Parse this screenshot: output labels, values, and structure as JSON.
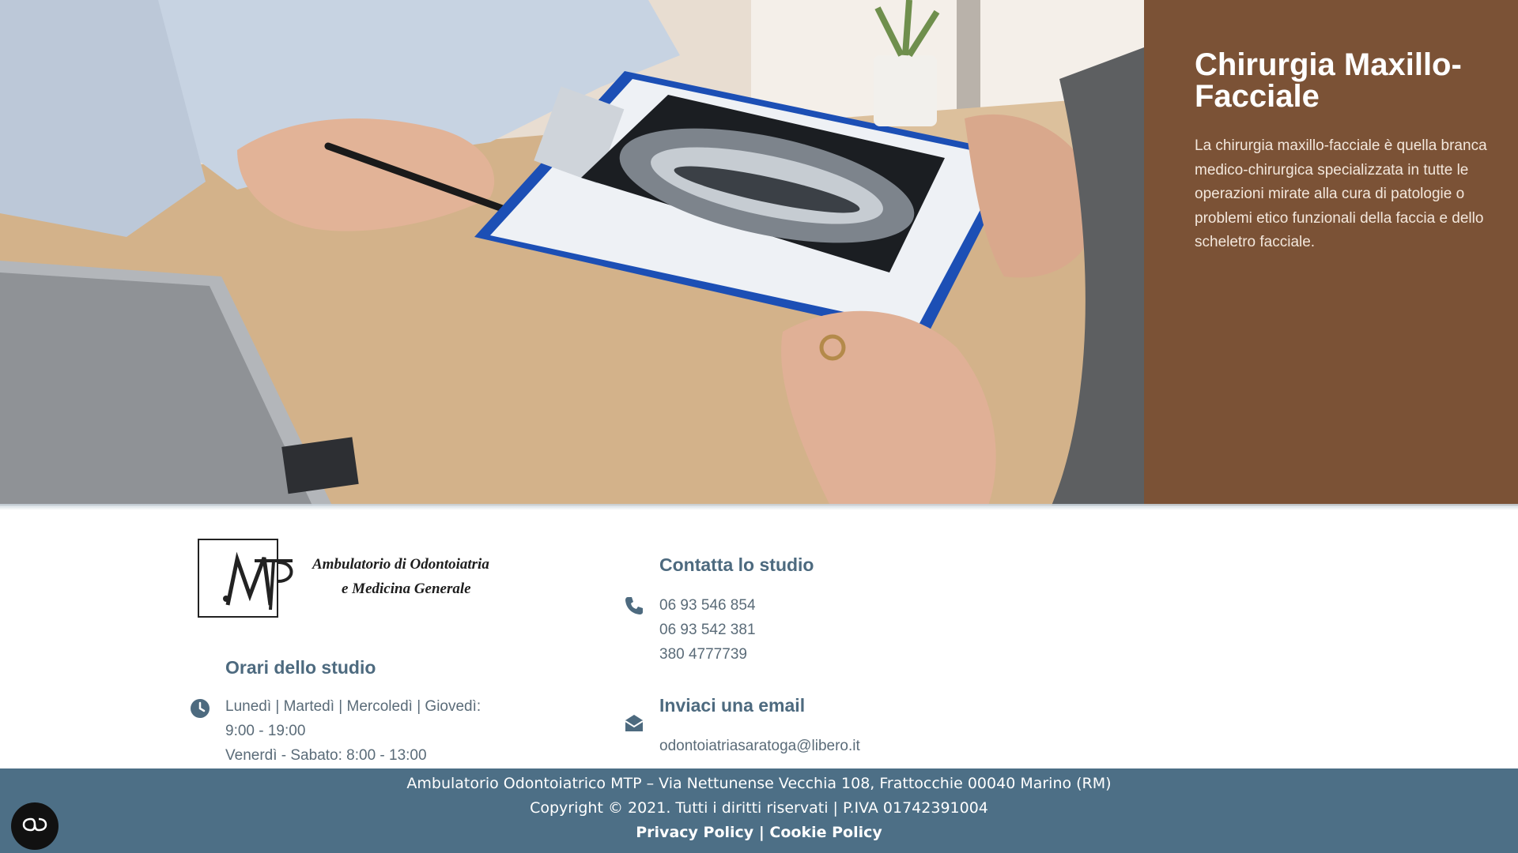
{
  "hero": {
    "title": "Chirurgia Maxillo-Facciale",
    "description": "La chirurgia maxillo-facciale è quella branca medico-chirurgica specializzata in tutte le operazioni mirate alla cura di patologie o problemi etico funzionali della faccia e dello scheletro facciale.",
    "panel_color": "#7b5236"
  },
  "logo": {
    "mark": "MTP",
    "line1": "Ambulatorio di Odontoiatria",
    "line2": "e Medicina Generale"
  },
  "hours": {
    "title": "Orari dello studio",
    "line1": "Lunedì | Martedì | Mercoledì | Giovedì:",
    "line2": "9:00 - 19:00",
    "line3": "Venerdì - Sabato: 8:00 - 13:00",
    "icon": "clock-icon"
  },
  "contact": {
    "title": "Contatta lo studio",
    "phones": [
      "06 93 546 854",
      "06 93 542 381",
      "380 4777739"
    ],
    "icon": "phone-icon"
  },
  "email": {
    "title": "Inviaci una email",
    "address": "odontoiatriasaratoga@libero.it",
    "icon": "envelope-icon"
  },
  "footer": {
    "address": "Ambulatorio Odontoiatrico MTP – Via Nettunense Vecchia 108, Frattocchie 00040 Marino (RM)",
    "copyright": "Copyright © 2021. Tutti i diritti riservati | P.IVA 01742391004",
    "privacy_label": "Privacy Policy",
    "separator": "|",
    "cookie_label": "Cookie Policy",
    "bar_color": "#4d6f86"
  },
  "accessibility": {
    "icon": "accessibility-toggle-icon"
  }
}
